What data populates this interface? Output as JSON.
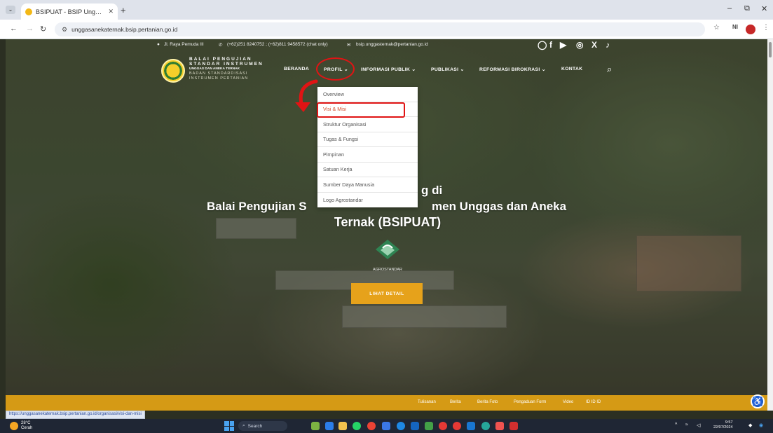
{
  "browser": {
    "tab_title": "BSIPUAT - BSIP Unggas dan A",
    "tab_close": "✕",
    "new_tab": "+",
    "url": "unggasanekaternak.bsip.pertanian.go.id",
    "window_controls": [
      "–",
      "⧉",
      "✕"
    ]
  },
  "topbar": {
    "address": "Jl. Raya Pemuda III",
    "phone": "(+62)251 8240752 ; (+62)811 9458572 (chat only)",
    "email": "bsip.unggasternak@pertanian.go.id",
    "social_icons": [
      "whatsapp-icon",
      "facebook-icon",
      "youtube-icon",
      "instagram-icon",
      "x-icon",
      "tiktok-icon"
    ]
  },
  "logo": {
    "line1": "BALAI PENGUJIAN",
    "line2": "STANDAR INSTRUMEN",
    "line3": "UNGGAS DAN ANEKA TERNAK",
    "line4": "BADAN STANDARDISASI",
    "line5": "INSTRUMEN PERTANIAN"
  },
  "nav": {
    "items": [
      {
        "label": "BERANDA"
      },
      {
        "label": "PROFIL ⌄"
      },
      {
        "label": "INFORMASI PUBLIK ⌄"
      },
      {
        "label": "PUBLIKASI ⌄"
      },
      {
        "label": "REFORMASI BIROKRASI ⌄"
      },
      {
        "label": "KONTAK"
      }
    ]
  },
  "dropdown": {
    "items": [
      {
        "label": "Overview"
      },
      {
        "label": "Visi & Misi"
      },
      {
        "label": "Struktur Organisasi"
      },
      {
        "label": "Tugas & Fungsi"
      },
      {
        "label": "Pimpinan"
      },
      {
        "label": "Satuan Kerja"
      },
      {
        "label": "Sumber Daya Manusia"
      },
      {
        "label": "Logo Agrostandar"
      }
    ],
    "active_index": 1
  },
  "hero": {
    "fragment_left": "Balai Pengujian S",
    "fragment_right": "g di",
    "title_rest": "men Unggas dan Aneka",
    "title_line2": "Ternak (BSIPUAT)",
    "logo_caption": "AGROSTANDAR",
    "button_label": "LIHAT DETAIL"
  },
  "footer_links": [
    "Tulisanan",
    "Berita",
    "Berita Foto",
    "Pengaduan Form",
    "Video",
    "ID ID ID"
  ],
  "status_url": "https://unggasanekaternak.bsip.pertanian.go.id/organisasi/visi-dan-misi",
  "taskbar": {
    "weather_temp": "28°C",
    "weather_desc": "Cerah",
    "search_placeholder": "Search",
    "time": "9:57",
    "date": "22/07/2024"
  },
  "colors": {
    "accent": "#e6a21b",
    "highlight": "#e01414",
    "footer": "#d59a15"
  }
}
